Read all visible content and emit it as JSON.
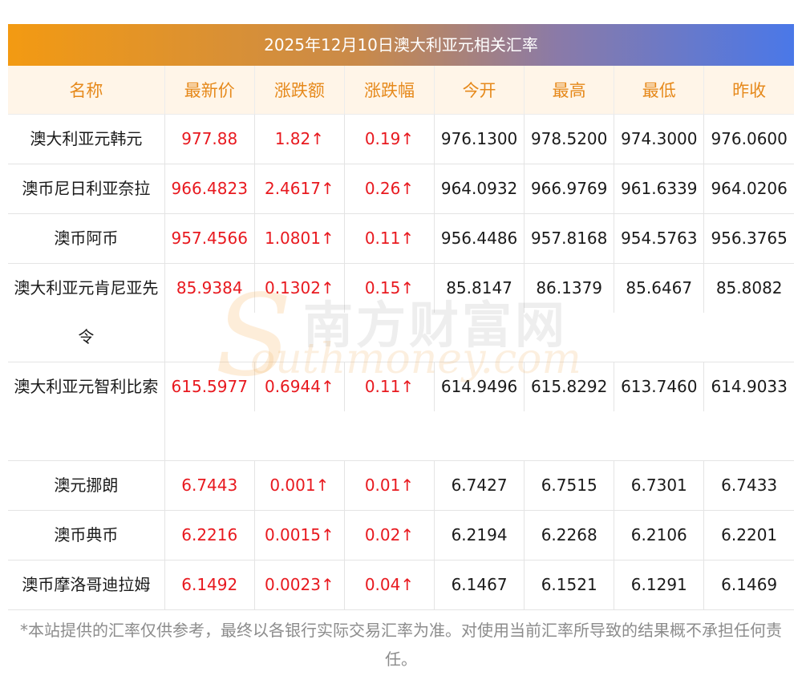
{
  "title": "2025年12月10日澳大利亚元相关汇率",
  "headers": [
    "名称",
    "最新价",
    "涨跌额",
    "涨跌幅",
    "今开",
    "最高",
    "最低",
    "昨收"
  ],
  "rows": [
    {
      "name": "澳大利亚元韩元",
      "last": "977.88",
      "change": "1.82↑",
      "pct": "0.19↑",
      "open": "976.1300",
      "high": "978.5200",
      "low": "974.3000",
      "prev": "976.0600"
    },
    {
      "name": "澳币尼日利亚奈拉",
      "last": "966.4823",
      "change": "2.4617↑",
      "pct": "0.26↑",
      "open": "964.0932",
      "high": "966.9769",
      "low": "961.6339",
      "prev": "964.0206"
    },
    {
      "name": "澳币阿币",
      "last": "957.4566",
      "change": "1.0801↑",
      "pct": "0.11↑",
      "open": "956.4486",
      "high": "957.8168",
      "low": "954.5763",
      "prev": "956.3765"
    },
    {
      "name": "澳大利亚元肯尼亚先令",
      "last": "85.9384",
      "change": "0.1302↑",
      "pct": "0.15↑",
      "open": "85.8147",
      "high": "86.1379",
      "low": "85.6467",
      "prev": "85.8082"
    },
    {
      "name": "澳大利亚元智利比索",
      "last": "615.5977",
      "change": "0.6944↑",
      "pct": "0.11↑",
      "open": "614.9496",
      "high": "615.8292",
      "low": "613.7460",
      "prev": "614.9033"
    },
    {
      "name": "澳元挪朗",
      "last": "6.7443",
      "change": "0.001↑",
      "pct": "0.01↑",
      "open": "6.7427",
      "high": "6.7515",
      "low": "6.7301",
      "prev": "6.7433"
    },
    {
      "name": "澳币典币",
      "last": "6.2216",
      "change": "0.0015↑",
      "pct": "0.02↑",
      "open": "6.2194",
      "high": "6.2268",
      "low": "6.2106",
      "prev": "6.2201"
    },
    {
      "name": "澳币摩洛哥迪拉姆",
      "last": "6.1492",
      "change": "0.0023↑",
      "pct": "0.04↑",
      "open": "6.1467",
      "high": "6.1521",
      "low": "6.1291",
      "prev": "6.1469"
    }
  ],
  "watermark": {
    "cn": "南方财富网",
    "en": "outhmoney.com",
    "s": "S"
  },
  "disclaimer": "*本站提供的汇率仅供参考，最终以各银行实际交易汇率为准。对使用当前汇率所导致的结果概不承担任何责任。",
  "colors": {
    "header_text": "#e6891b",
    "header_bg": "#fff5e8",
    "up": "#e8191f",
    "gradient_start": "#f39a12",
    "gradient_end": "#4a78e8"
  }
}
